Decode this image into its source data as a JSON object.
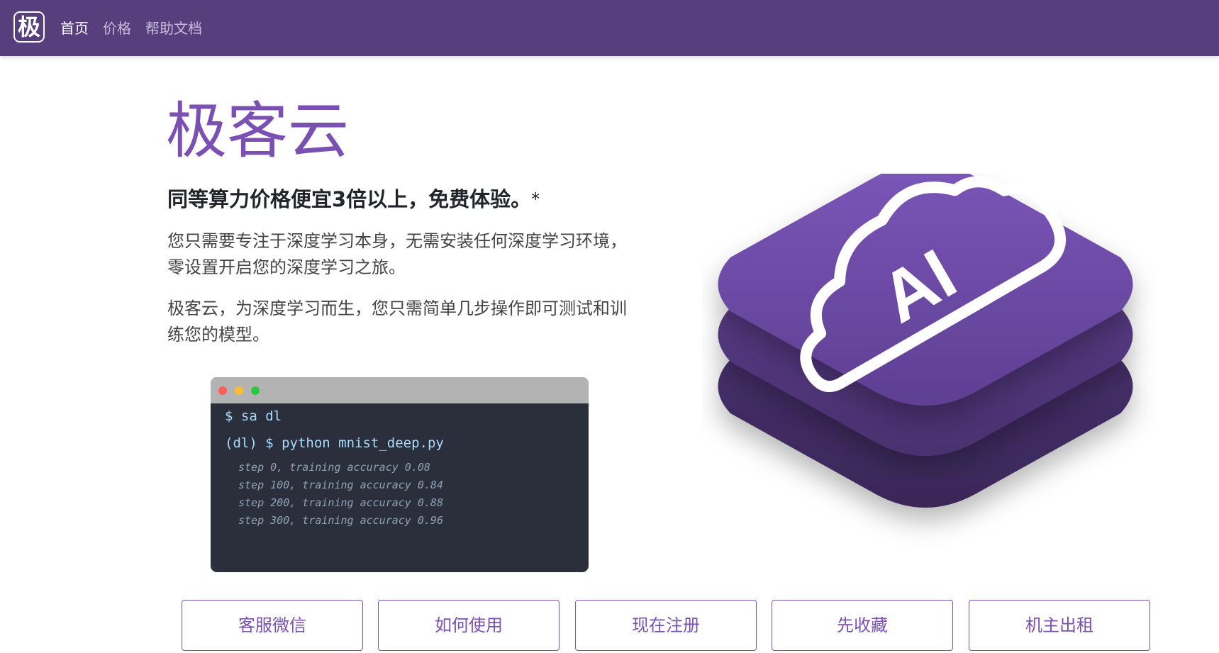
{
  "nav": {
    "logo_char": "极",
    "links": [
      "首页",
      "价格",
      "帮助文档"
    ]
  },
  "hero": {
    "title": "极客云",
    "subtitle": "同等算力价格便宜3倍以上，免费体验。",
    "subtitle_mark": "*",
    "paragraph1": "您只需要专注于深度学习本身，无需安装任何深度学习环境，零设置开启您的深度学习之旅。",
    "paragraph2": "极客云，为深度学习而生，您只需简单几步操作即可测试和训练您的模型。"
  },
  "terminal": {
    "cmd1": "$ sa dl",
    "cmd2": "(dl) $ python mnist_deep.py",
    "output": [
      "step 0, training accuracy 0.08",
      "step 100, training accuracy 0.84",
      "step 200, training accuracy 0.88",
      "step 300, training accuracy 0.96"
    ]
  },
  "illustration": {
    "label": "AI"
  },
  "buttons": [
    "客服微信",
    "如何使用",
    "现在注册",
    "先收藏",
    "机主出租"
  ],
  "colors": {
    "nav_bg": "#573e7c",
    "accent": "#7b50b3",
    "terminal_bg": "#2b2f3b",
    "terminal_text": "#a8dcff"
  }
}
